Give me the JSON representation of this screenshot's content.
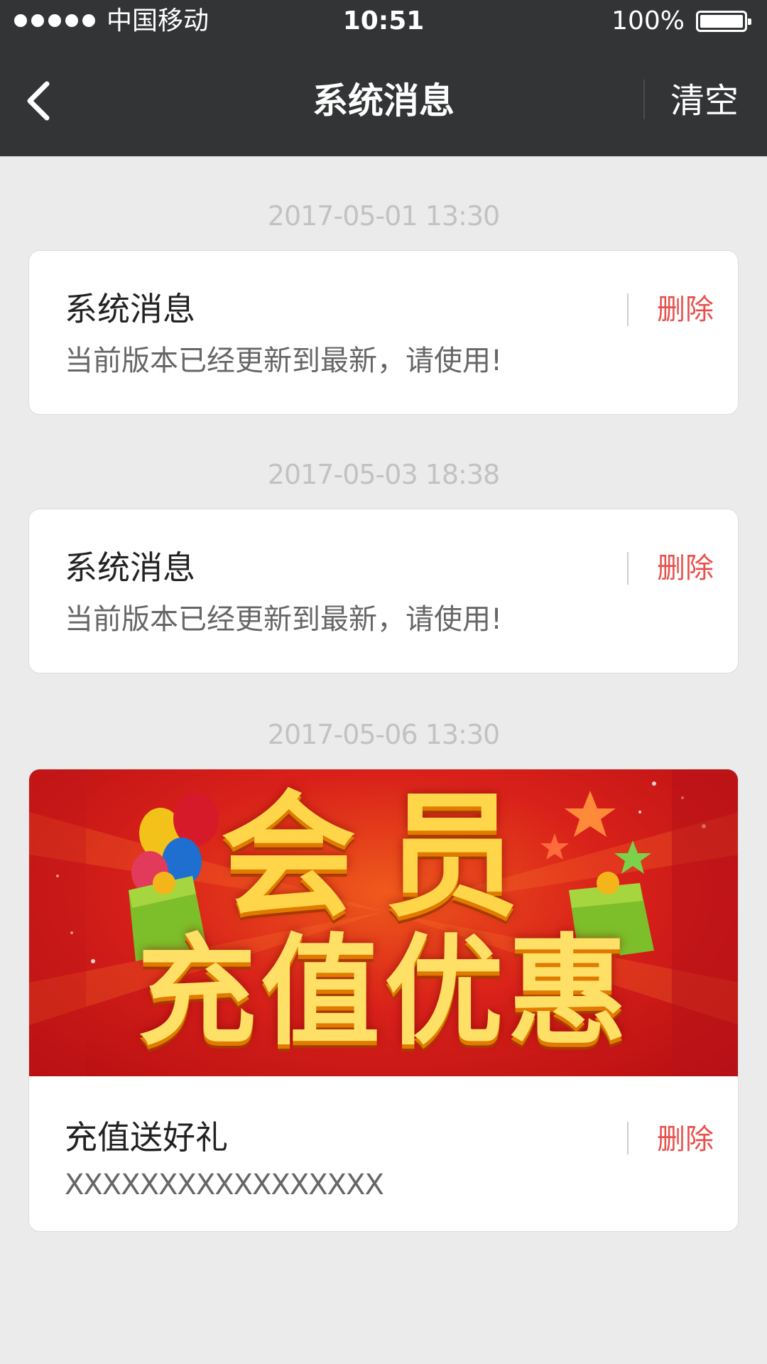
{
  "status_bar": {
    "carrier": "中国移动",
    "time": "10:51",
    "battery": "100%",
    "signal_bars": 5,
    "battery_level": 1.0
  },
  "nav": {
    "back_icon": "chevron-left-icon",
    "title": "系统消息",
    "clear_label": "清空"
  },
  "messages": [
    {
      "timestamp": "2017-05-01  13:30",
      "title": "系统消息",
      "body": "当前版本已经更新到最新，请使用!",
      "delete_label": "删除"
    },
    {
      "timestamp": "2017-05-03  18:38",
      "title": "系统消息",
      "body": "当前版本已经更新到最新，请使用!",
      "delete_label": "删除"
    },
    {
      "timestamp": "2017-05-06  13:30",
      "title": "充值送好礼",
      "body": "XXXXXXXXXXXXXXXXX",
      "delete_label": "删除",
      "banner": {
        "line1": "会员",
        "line2": "充值优惠"
      }
    }
  ],
  "colors": {
    "bar_background": "#323435",
    "page_background": "#ebebeb",
    "delete_red": "#e8504c",
    "timestamp_gray": "#c2c2c2"
  }
}
